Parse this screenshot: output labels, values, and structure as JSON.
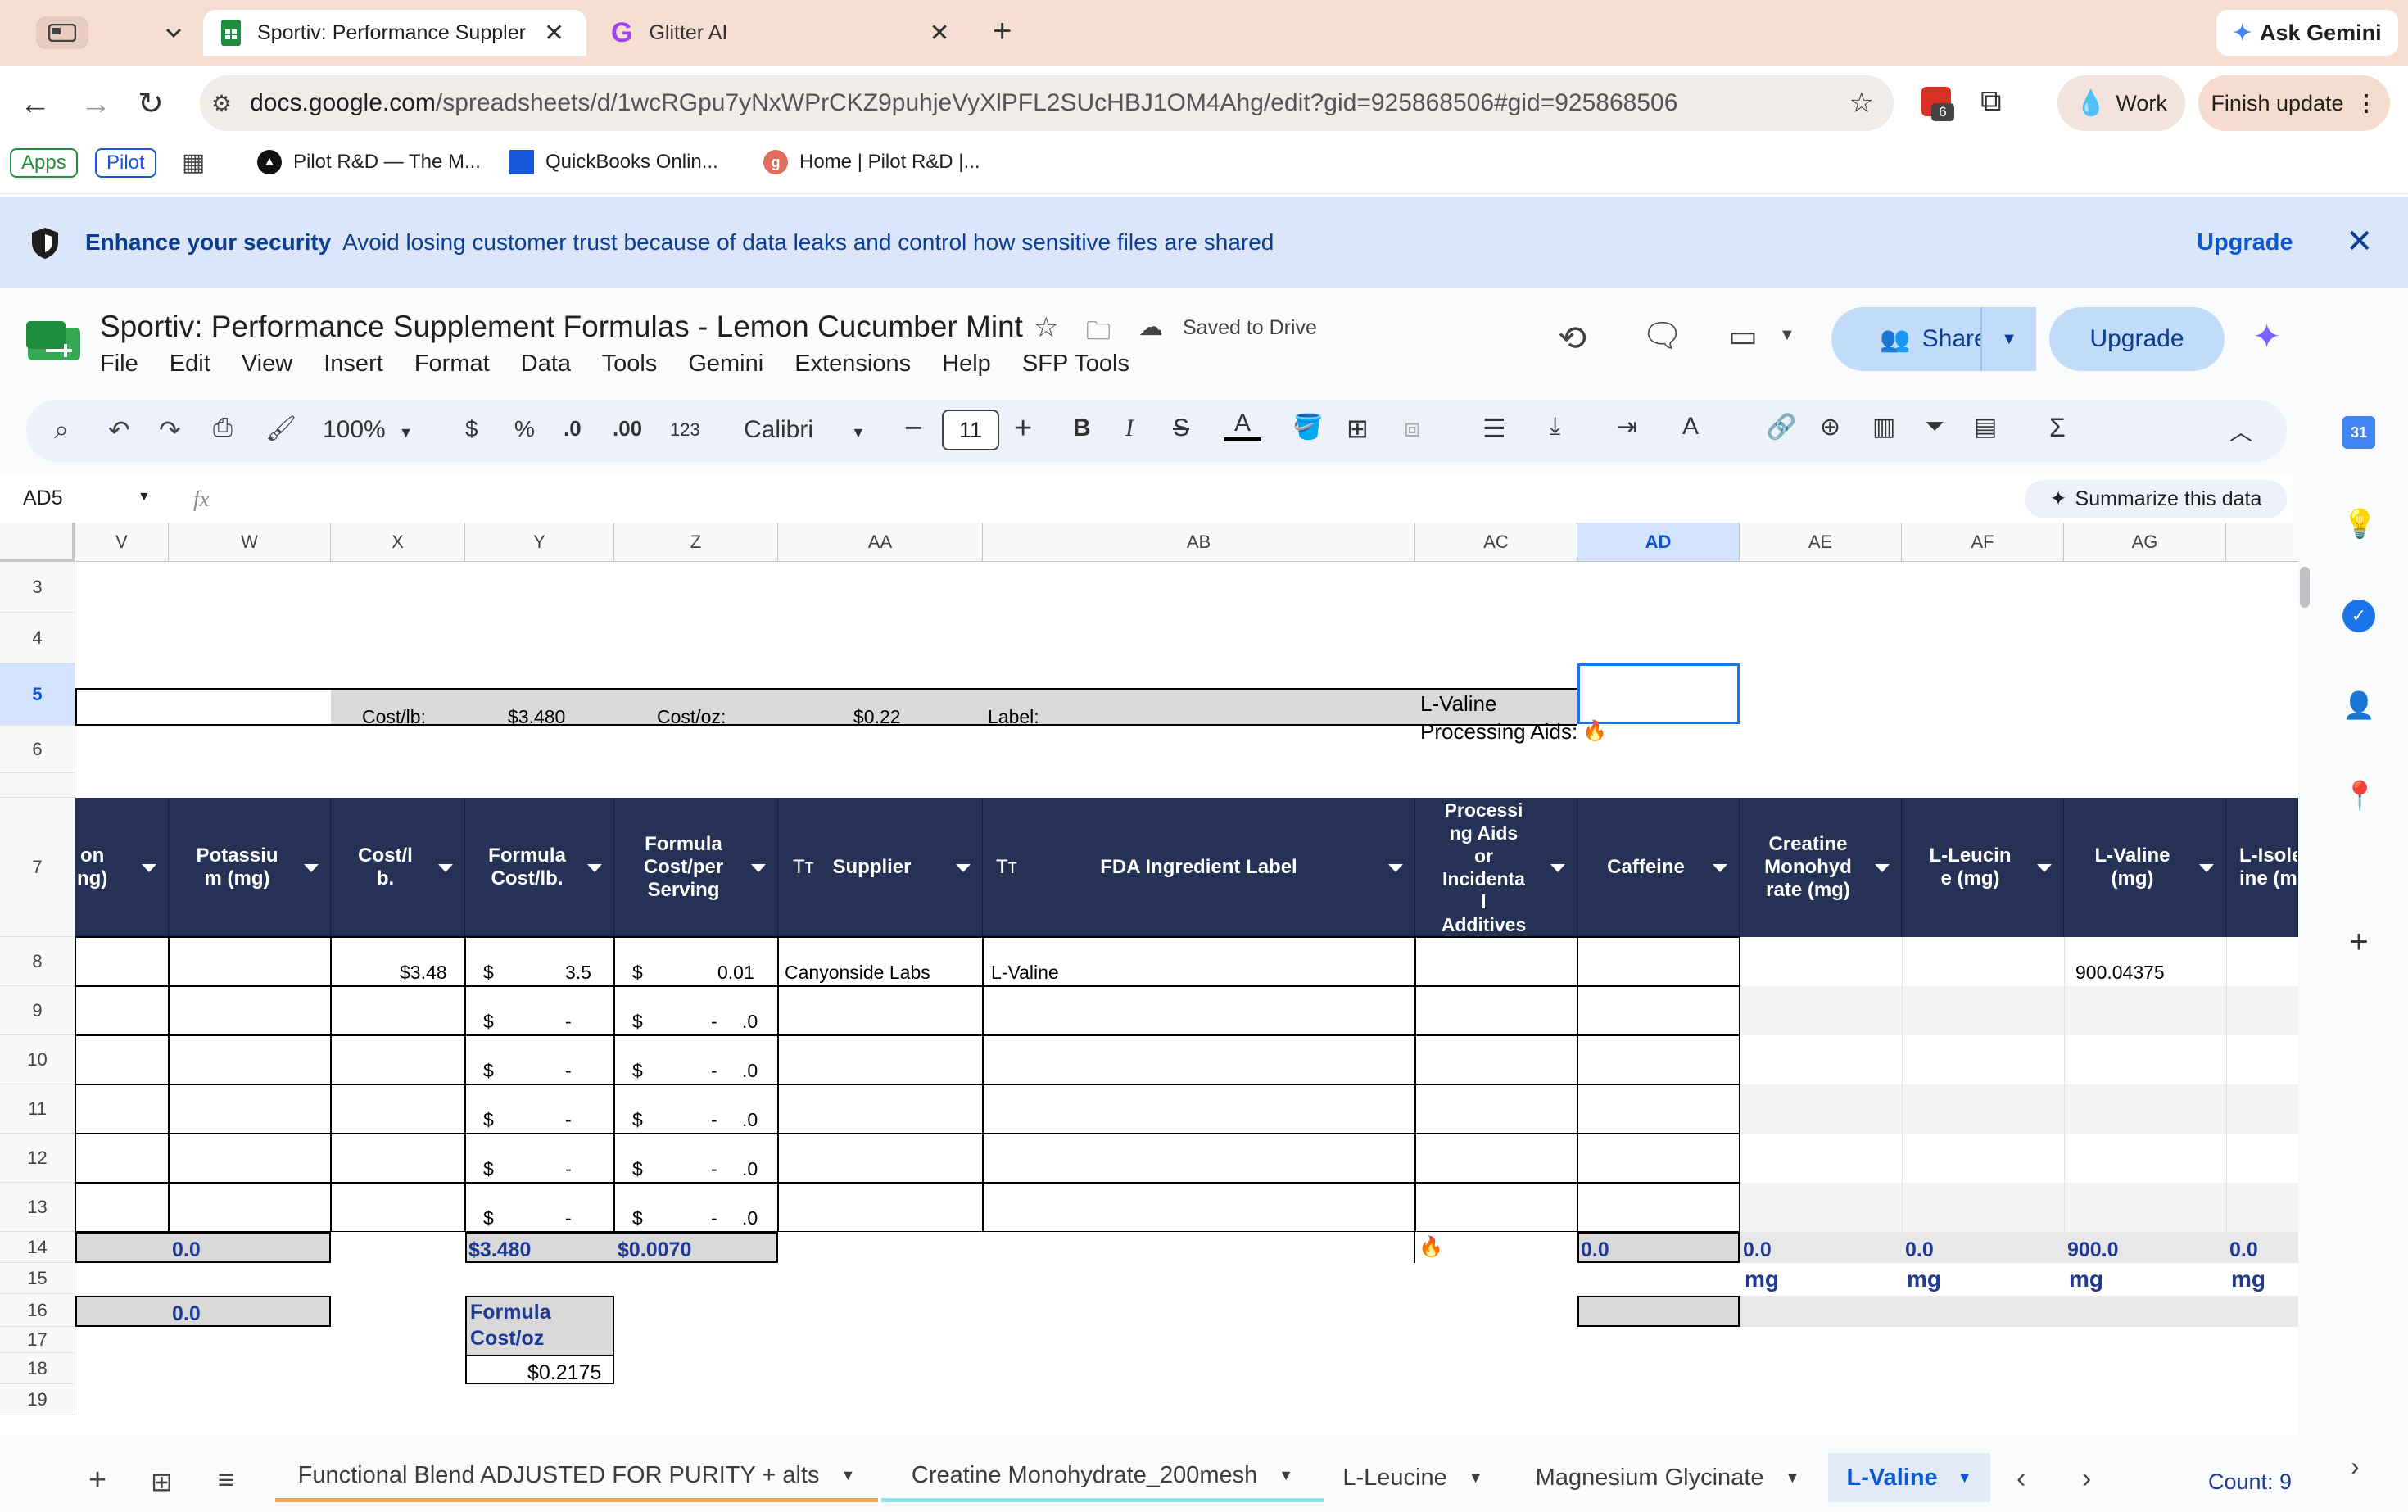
{
  "browser": {
    "tabs": [
      {
        "title": "Sportiv: Performance Suppler",
        "active": true
      },
      {
        "title": "Glitter AI",
        "active": false
      }
    ],
    "ask_gemini": "Ask Gemini",
    "url_host": "docs.google.com",
    "url_path": "/spreadsheets/d/1wcRGpu7yNxWPrCKZ9puhjeVyXlPFL2SUcHBJ1OM4Ahg/edit?gid=925868506#gid=925868506",
    "extensions_badge": "6",
    "profile": "Work",
    "finish_update": "Finish update",
    "bookmarks": [
      "Apps",
      "Pilot",
      "Pilot R&D — The M...",
      "QuickBooks Onlin...",
      "Home | Pilot R&D |..."
    ]
  },
  "banner": {
    "bold": "Enhance your security",
    "text": "Avoid losing customer trust because of data leaks and control how sensitive files are shared",
    "upgrade": "Upgrade"
  },
  "doc": {
    "title": "Sportiv: Performance Supplement Formulas - Lemon Cucumber Mint",
    "saved": "Saved to Drive",
    "menu": [
      "File",
      "Edit",
      "View",
      "Insert",
      "Format",
      "Data",
      "Tools",
      "Gemini",
      "Extensions",
      "Help",
      "SFP Tools"
    ],
    "share": "Share",
    "upgrade": "Upgrade"
  },
  "format_toolbar": {
    "zoom": "100%",
    "currency": "$",
    "percent": "%",
    "dec_less": ".0",
    "dec_more": ".00",
    "numfmt": "123",
    "font": "Calibri",
    "font_size": "11"
  },
  "formula_bar": {
    "cell_ref": "AD5",
    "fx": "fx",
    "summarize": "Summarize this data"
  },
  "columns": [
    "V",
    "W",
    "X",
    "Y",
    "Z",
    "AA",
    "AB",
    "AC",
    "AD",
    "AE",
    "AF",
    "AG"
  ],
  "rows": [
    "3",
    "4",
    "5",
    "6",
    "7",
    "8",
    "9",
    "10",
    "11",
    "12",
    "13",
    "14",
    "15",
    "16",
    "17",
    "18",
    "19"
  ],
  "row5": {
    "cost_lb_label": "Cost/lb:",
    "cost_lb_value": "$3.480",
    "cost_oz_label": "Cost/oz:",
    "cost_oz_value": "$0.22",
    "label_label": "Label:",
    "processing_line1": "L-Valine",
    "processing_line2": "Processing Aids:",
    "flame": "🔥"
  },
  "header_row": {
    "v": "on\nng)",
    "w": "Potassiu\nm (mg)",
    "x": "Cost/l\nb.",
    "y": "Formula\nCost/lb.",
    "z": "Formula\nCost/per\nServing",
    "aa": "Supplier",
    "ab": "FDA Ingredient Label",
    "ac": "Processi\nng Aids\nor\nIncidenta\nl\nAdditives",
    "ad": "Caffeine",
    "ae": "Creatine\nMonohyd\nrate (mg)",
    "af": "L-Leucin\ne (mg)",
    "ag": "L-Valine\n(mg)",
    "ah": "L-Isole\nine (m",
    "tt": "Tт"
  },
  "row8": {
    "x": "$3.48",
    "y_sym": "$",
    "y_val": "3.5",
    "z_sym": "$",
    "z_val": "0.01",
    "aa": "Canyonside Labs",
    "ab": "L-Valine",
    "ag": "900.04375"
  },
  "empty_rows": {
    "sym": "$",
    "dash": "-",
    "dot0": ".0"
  },
  "row14": {
    "w": "0.0",
    "y": "$3.480",
    "z": "$0.0070",
    "ac": "🔥",
    "ad": "0.0",
    "ae": "0.0",
    "af": "0.0",
    "ag": "900.0",
    "ah": "0.0"
  },
  "row15": {
    "unit": "mg"
  },
  "row16": {
    "w": "0.0",
    "y_line1": "Formula",
    "y_line2": "Cost/oz"
  },
  "row18": {
    "y": "$0.2175"
  },
  "sheet_tabs": [
    "Functional Blend ADJUSTED FOR PURITY + alts",
    "Creatine Monohydrate_200mesh",
    "L-Leucine",
    "Magnesium Glycinate",
    "L-Valine"
  ],
  "status": {
    "count": "Count: 9"
  },
  "colors": {
    "header_navy": "#253155",
    "accent_blue": "#0b57d0",
    "banner_bg": "#dbe6fb",
    "tab_strip": "#f6dfd2"
  }
}
